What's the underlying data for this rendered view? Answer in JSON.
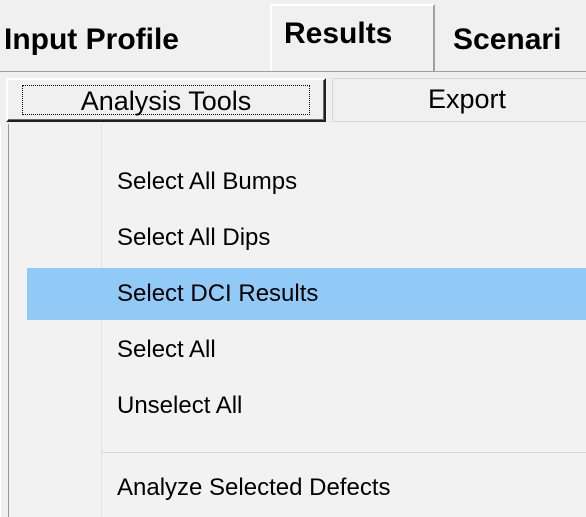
{
  "tabs": [
    {
      "label": "Input Profile"
    },
    {
      "label": "Results"
    },
    {
      "label": "Scenari"
    }
  ],
  "toolbar": {
    "analysis_tools_label": "Analysis Tools",
    "export_label": "Export"
  },
  "menu": {
    "items": [
      {
        "label": "Select All Bumps"
      },
      {
        "label": "Select All Dips"
      },
      {
        "label": "Select DCI Results"
      },
      {
        "label": "Select All"
      },
      {
        "label": "Unselect All"
      },
      {
        "label": "Analyze Selected Defects"
      }
    ],
    "highlighted_index": 2,
    "highlight_color": "#91c9f7"
  }
}
